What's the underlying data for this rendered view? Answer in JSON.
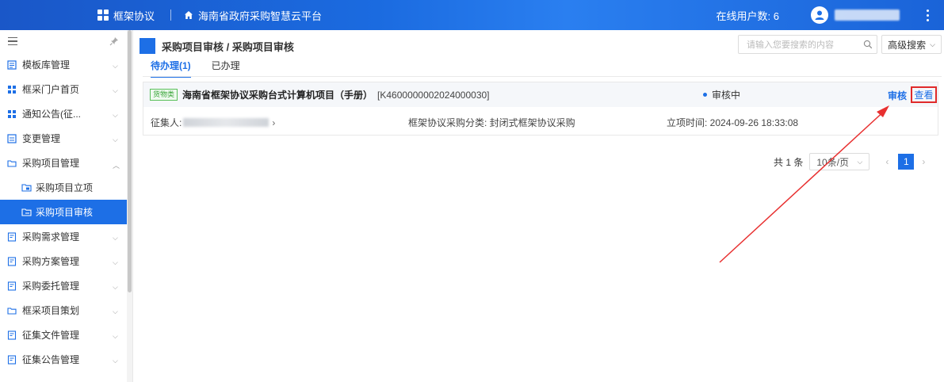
{
  "topbar": {
    "brand": "框架协议",
    "platform": "海南省政府采购智慧云平台",
    "online_users": "在线用户数: 6"
  },
  "sidebar": {
    "items": [
      {
        "label": "模板库管理",
        "icon": "template-icon"
      },
      {
        "label": "框采门户首页",
        "icon": "grid-icon"
      },
      {
        "label": "通知公告(征...",
        "icon": "grid-icon"
      },
      {
        "label": "变更管理",
        "icon": "change-icon"
      },
      {
        "label": "采购项目管理",
        "icon": "folder-icon"
      },
      {
        "label": "采购需求管理",
        "icon": "doc-icon"
      },
      {
        "label": "采购方案管理",
        "icon": "doc-icon"
      },
      {
        "label": "采购委托管理",
        "icon": "doc-icon"
      },
      {
        "label": "框采项目策划",
        "icon": "folder-icon"
      },
      {
        "label": "征集文件管理",
        "icon": "doc-icon"
      },
      {
        "label": "征集公告管理",
        "icon": "doc-icon"
      }
    ],
    "sub_items": [
      {
        "label": "采购项目立项"
      },
      {
        "label": "采购项目审核"
      }
    ]
  },
  "main": {
    "title": "采购项目审核 / 采购项目审核",
    "search_placeholder": "请输入您要搜索的内容",
    "advanced_search": "高级搜索",
    "tabs": [
      {
        "label": "待办理(1)"
      },
      {
        "label": "已办理"
      }
    ],
    "card": {
      "tag": "货物类",
      "project_name": "海南省框架协议采购台式计算机项目（手册）",
      "project_code": "[K4600000002024000030]",
      "status": "审核中",
      "action_review": "审核",
      "action_view": "查看",
      "collector_label": "征集人:",
      "collector_tail": "›",
      "category": "框架协议采购分类: 封闭式框架协议采购",
      "created_time": "立项时间: 2024-09-26 18:33:08"
    },
    "pagination": {
      "total": "共 1 条",
      "page_size": "10条/页",
      "current_page": "1"
    }
  },
  "colors": {
    "primary": "#1d6fe6",
    "highlight_box": "#e02a2a"
  }
}
